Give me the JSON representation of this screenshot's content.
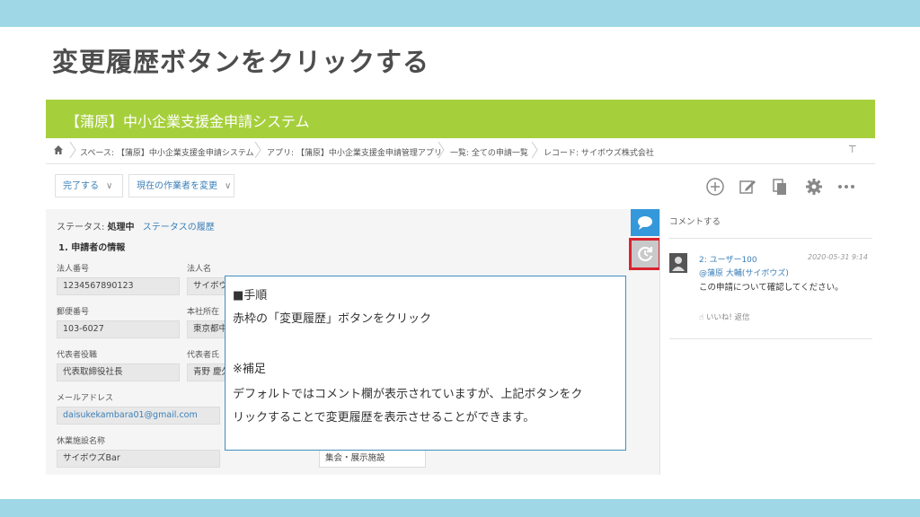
{
  "slide": {
    "title": "変更履歴ボタンをクリックする"
  },
  "app": {
    "header_title": "【蒲原】中小企業支援金申請システム",
    "breadcrumb": [
      "スペース: 【蒲原】中小企業支援金申請システム",
      "アプリ: 【蒲原】中小企業支援金申請管理アプリ",
      "一覧: 全ての申請一覧",
      "レコード: サイボウズ株式会社"
    ],
    "toolbar": {
      "complete_label": "完了する",
      "change_assignee_label": "現在の作業者を変更"
    },
    "status": {
      "label": "ステータス:",
      "value": "処理中",
      "history_link": "ステータスの履歴"
    },
    "section_title": "1. 申請者の情報",
    "fields": {
      "corporate_number_label": "法人番号",
      "corporate_number_value": "1234567890123",
      "corporate_name_label": "法人名",
      "corporate_name_value": "サイボウ",
      "postal_label": "郵便番号",
      "postal_value": "103-6027",
      "address_label": "本社所在",
      "address_value": "東京都中",
      "rep_title_label": "代表者役職",
      "rep_title_value": "代表取締役社長",
      "rep_name_label": "代表者氏",
      "rep_name_value": "青野 慶久",
      "email_label": "メールアドレス",
      "email_value": "daisukekambara01@gmail.com",
      "facility_name_label": "休業施設名称",
      "facility_name_value": "サイボウズBar",
      "facility_type_value": "集会・展示施設"
    },
    "comments": {
      "input_placeholder": "コメントする",
      "items": [
        {
          "user": "2: ユーザー100",
          "date": "2020-05-31 9:14",
          "mention": "@蒲原 大輔(サイボウズ)",
          "body": "この申請について確認してください。",
          "actions": "いいね!  返信"
        }
      ]
    }
  },
  "note": {
    "heading": "■手順",
    "step": "赤枠の「変更履歴」ボタンをクリック",
    "supplement_heading": "※補足",
    "supplement_line1": "デフォルトではコメント欄が表示されていますが、上記ボタンをク",
    "supplement_line2": "リックすることで変更履歴を表示させることができます。"
  },
  "colors": {
    "top_band": "#9fd7e6",
    "app_header": "#a6cf3c",
    "comment_tab": "#3498db",
    "highlight": "#d9232f",
    "note_border": "#3f8fc0"
  }
}
